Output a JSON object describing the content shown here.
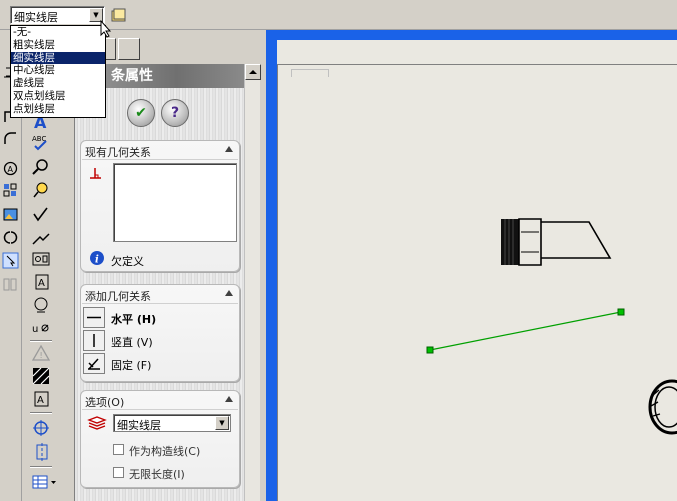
{
  "toolbar": {
    "layer_value": "细实线层"
  },
  "layer_dropdown": {
    "options": [
      "-无-",
      "粗实线层",
      "细实线层",
      "中心线层",
      "虚线层",
      "双点划线层",
      "点划线层"
    ],
    "selected_index": 2
  },
  "panel": {
    "title": "条属性",
    "ok_icon": "check-icon",
    "help_icon": "help-icon",
    "existing_relations": {
      "title": "现有几何关系",
      "status": "欠定义"
    },
    "add_relations": {
      "title": "添加几何关系",
      "items": [
        {
          "label": "水平 (H)",
          "icon": "horizontal-icon"
        },
        {
          "label": "竖直 (V)",
          "icon": "vertical-icon"
        },
        {
          "label": "固定 (F)",
          "icon": "fix-icon"
        }
      ]
    },
    "options": {
      "title": "选项(O)",
      "layer_value": "细实线层",
      "construction_label": "作为构造线(C)",
      "infinite_label": "无限长度(I)",
      "construction_checked": false,
      "infinite_checked": false
    }
  },
  "colors": {
    "selection": "#0a246a",
    "sketch_line": "#00a000",
    "graphics_bg": "#eae8e1",
    "viewport_frame": "#1a62e8"
  }
}
